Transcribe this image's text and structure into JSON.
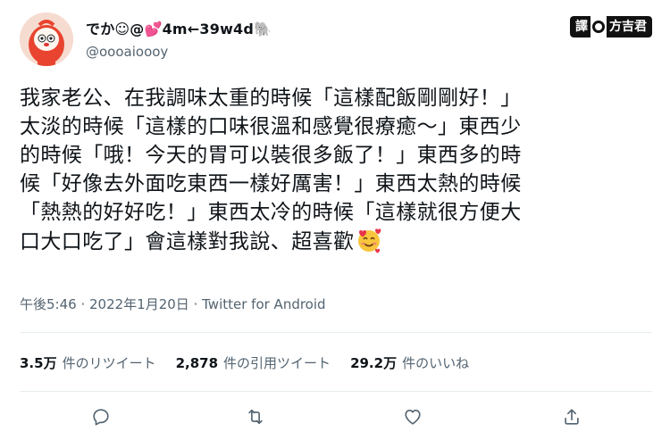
{
  "user": {
    "display_name": "でか☺@💕4m←39w4d🐘",
    "handle": "@oooaioooy"
  },
  "translator_badge": {
    "left": "譯",
    "right": "方吉君"
  },
  "tweet": {
    "lines": [
      "我家老公、在我調味太重的時候「這樣配飯剛剛好！」",
      "太淡的時候「這樣的口味很溫和感覺很療癒～」東西少",
      "的時候「哦！今天的胃可以裝很多飯了！」東西多的時",
      "候「好像去外面吃東西一樣好厲害！」東西太熱的時候",
      "「熱熱的好好吃！」東西太冷的時候「這樣就很方便大",
      "口大口吃了」會這樣對我說、超喜歡"
    ],
    "end_emoji": "smiling-face-with-hearts-icon"
  },
  "meta": {
    "time": "午後5:46",
    "date": "2022年1月20日",
    "source": "Twitter for Android",
    "separator": " · "
  },
  "stats": {
    "retweets_value": "3.5万",
    "retweets_label": "件のリツイート",
    "quotes_value": "2,878",
    "quotes_label": "件の引用ツイート",
    "likes_value": "29.2万",
    "likes_label": "件のいいね"
  },
  "actions": [
    "reply-icon",
    "retweet-icon",
    "like-icon",
    "share-icon"
  ],
  "colors": {
    "text": "#0f1419",
    "secondary": "#536471",
    "divider": "#e6ecf0",
    "avatar_red": "#e8442f"
  }
}
